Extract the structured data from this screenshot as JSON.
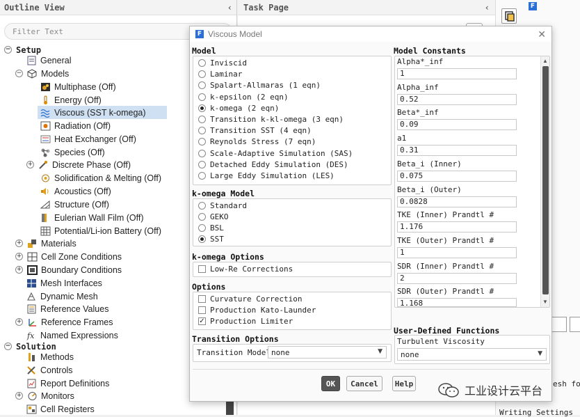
{
  "outline": {
    "title": "Outline View",
    "collapse": "‹",
    "filter_placeholder": "Filter Text",
    "tree": {
      "setup": "Setup",
      "general": "General",
      "models": "Models",
      "multiphase": "Multiphase (Off)",
      "energy": "Energy (Off)",
      "viscous": "Viscous (SST k-omega)",
      "radiation": "Radiation (Off)",
      "heat_exchanger": "Heat Exchanger (Off)",
      "species": "Species (Off)",
      "discrete_phase": "Discrete Phase (Off)",
      "solidification": "Solidification & Melting (Off)",
      "acoustics": "Acoustics (Off)",
      "structure": "Structure (Off)",
      "eulerian_wall_film": "Eulerian Wall Film (Off)",
      "potential": "Potential/Li-ion Battery (Off)",
      "materials": "Materials",
      "cell_zone": "Cell Zone Conditions",
      "boundary": "Boundary Conditions",
      "mesh_interfaces": "Mesh Interfaces",
      "dynamic_mesh": "Dynamic Mesh",
      "reference_values": "Reference Values",
      "reference_frames": "Reference Frames",
      "named_expressions": "Named Expressions",
      "solution": "Solution",
      "methods": "Methods",
      "controls": "Controls",
      "report_definitions": "Report Definitions",
      "monitors": "Monitors",
      "cell_registers": "Cell Registers"
    }
  },
  "taskpage": {
    "title": "Task Page",
    "collapse": "‹"
  },
  "console": {
    "line1": "esh fo",
    "line2": "Writing Settings"
  },
  "dialog": {
    "title": "Viscous Model",
    "close": "✕",
    "model": {
      "label": "Model",
      "options": [
        "Inviscid",
        "Laminar",
        "Spalart-Allmaras (1 eqn)",
        "k-epsilon (2 eqn)",
        "k-omega (2 eqn)",
        "Transition k-kl-omega (3 eqn)",
        "Transition SST (4 eqn)",
        "Reynolds Stress (7 eqn)",
        "Scale-Adaptive Simulation (SAS)",
        "Detached Eddy Simulation (DES)",
        "Large Eddy Simulation (LES)"
      ],
      "selected": "k-omega (2 eqn)"
    },
    "komega_model": {
      "label": "k-omega Model",
      "options": [
        "Standard",
        "GEKO",
        "BSL",
        "SST"
      ],
      "selected": "SST"
    },
    "komega_options": {
      "label": "k-omega Options",
      "low_re": "Low-Re Corrections",
      "low_re_checked": false
    },
    "options": {
      "label": "Options",
      "curvature": "Curvature Correction",
      "curvature_checked": false,
      "kato": "Production Kato-Launder",
      "kato_checked": false,
      "limiter": "Production Limiter",
      "limiter_checked": true
    },
    "transition": {
      "label": "Transition Options",
      "model_label": "Transition Model",
      "model_value": "none"
    },
    "constants": {
      "label": "Model Constants",
      "items": [
        {
          "name": "Alpha*_inf",
          "value": "1"
        },
        {
          "name": "Alpha_inf",
          "value": "0.52"
        },
        {
          "name": "Beta*_inf",
          "value": "0.09"
        },
        {
          "name": "a1",
          "value": "0.31"
        },
        {
          "name": "Beta_i (Inner)",
          "value": "0.075"
        },
        {
          "name": "Beta_i (Outer)",
          "value": "0.0828"
        },
        {
          "name": "TKE (Inner) Prandtl #",
          "value": "1.176"
        },
        {
          "name": "TKE (Outer) Prandtl #",
          "value": "1"
        },
        {
          "name": "SDR (Inner) Prandtl #",
          "value": "2"
        },
        {
          "name": "SDR (Outer) Prandtl #",
          "value": "1.168"
        }
      ]
    },
    "udf": {
      "label": "User-Defined Functions",
      "turbulent_viscosity": "Turbulent Viscosity",
      "value": "none"
    },
    "buttons": {
      "ok": "OK",
      "cancel": "Cancel",
      "help": "Help"
    }
  },
  "watermark": "工业设计云平台",
  "colors": {
    "selection": "#cfe0f2",
    "fluent_blue": "#2a6fd6",
    "ok_button": "#555555"
  }
}
